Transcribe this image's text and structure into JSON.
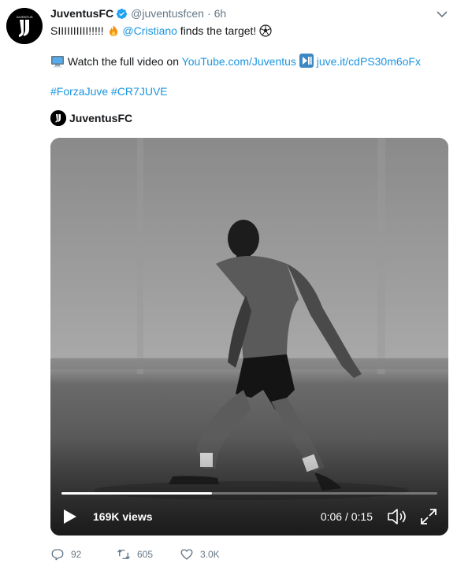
{
  "tweet": {
    "name": "JuventusFC",
    "handle": "@juventusfcen",
    "separator": "·",
    "time": "6h",
    "line1_text": "SIIIIIIIIII!!!!! ",
    "line1_mention": "@Cristiano",
    "line1_rest": " finds the target! ",
    "line2_text": " Watch the full video on ",
    "line2_link1": "YouTube.com/Juventus",
    "line2_link2": "juve.it/cdPS30m6oFx",
    "hashtags": "#ForzaJuve #CR7JUVE",
    "card_account": "JuventusFC"
  },
  "video": {
    "views": "169K views",
    "time": "0:06 / 0:15",
    "progress": 0.4
  },
  "actions": {
    "reply_count": "92",
    "retweet_count": "605",
    "like_count": "3.0K"
  },
  "icons": {
    "verified": "verified-badge-icon",
    "caret": "chevron-down-icon",
    "fire": "fire-emoji-icon",
    "ball": "soccer-ball-emoji-icon",
    "computer": "computer-emoji-icon",
    "play_pause": "play-pause-emoji-icon",
    "play": "play-icon",
    "volume": "volume-icon",
    "fullscreen": "fullscreen-icon",
    "reply": "reply-icon",
    "retweet": "retweet-icon",
    "like": "heart-icon"
  },
  "colors": {
    "link": "#1b95e0",
    "secondary": "#657786",
    "verified": "#1da1f2"
  }
}
